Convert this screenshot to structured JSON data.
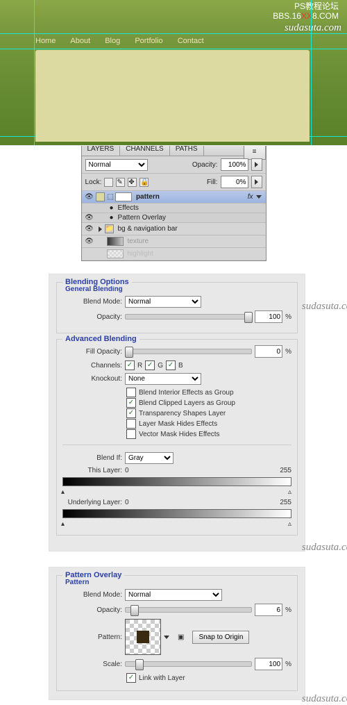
{
  "watermark_main": "sudasuta.com",
  "header": {
    "line1": "PS教程论坛",
    "line2a": "BBS.16",
    "line2b": "XX",
    "line2c": "8.COM",
    "nav": [
      "Home",
      "About",
      "Blog",
      "Portfolio",
      "Contact"
    ]
  },
  "layers_panel": {
    "tabs": [
      "LAYERS",
      "CHANNELS",
      "PATHS"
    ],
    "blend_mode": "Normal",
    "opacity_label": "Opacity:",
    "opacity_value": "100%",
    "lock_label": "Lock:",
    "fill_label": "Fill:",
    "fill_value": "0%",
    "items": [
      {
        "name": "pattern",
        "selected": true,
        "bold": true,
        "fx": "fx"
      },
      {
        "name": "Effects",
        "sub": true
      },
      {
        "name": "Pattern Overlay",
        "sub": true,
        "eye": true
      },
      {
        "name": "bg & navigation bar"
      },
      {
        "name": "texture"
      },
      {
        "name": "highlight"
      }
    ]
  },
  "blending_options": {
    "title": "Blending Options",
    "general": {
      "title": "General Blending",
      "mode_label": "Blend Mode:",
      "mode_value": "Normal",
      "opacity_label": "Opacity:",
      "opacity_value": "100",
      "pct": "%"
    },
    "advanced": {
      "title": "Advanced Blending",
      "fill_label": "Fill Opacity:",
      "fill_value": "0",
      "channels_label": "Channels:",
      "ch_r": "R",
      "ch_g": "G",
      "ch_b": "B",
      "knockout_label": "Knockout:",
      "knockout_value": "None",
      "opts": [
        {
          "label": "Blend Interior Effects as Group",
          "checked": false
        },
        {
          "label": "Blend Clipped Layers as Group",
          "checked": true
        },
        {
          "label": "Transparency Shapes Layer",
          "checked": true
        },
        {
          "label": "Layer Mask Hides Effects",
          "checked": false
        },
        {
          "label": "Vector Mask Hides Effects",
          "checked": false
        }
      ]
    },
    "blendif": {
      "label": "Blend If:",
      "value": "Gray",
      "this_label": "This Layer:",
      "this_lo": "0",
      "this_hi": "255",
      "under_label": "Underlying Layer:",
      "under_lo": "0",
      "under_hi": "255"
    }
  },
  "pattern_overlay": {
    "title": "Pattern Overlay",
    "sub": "Pattern",
    "mode_label": "Blend Mode:",
    "mode_value": "Normal",
    "opacity_label": "Opacity:",
    "opacity_value": "6",
    "pattern_label": "Pattern:",
    "snap": "Snap to Origin",
    "scale_label": "Scale:",
    "scale_value": "100",
    "link": "Link with Layer",
    "pct": "%"
  }
}
